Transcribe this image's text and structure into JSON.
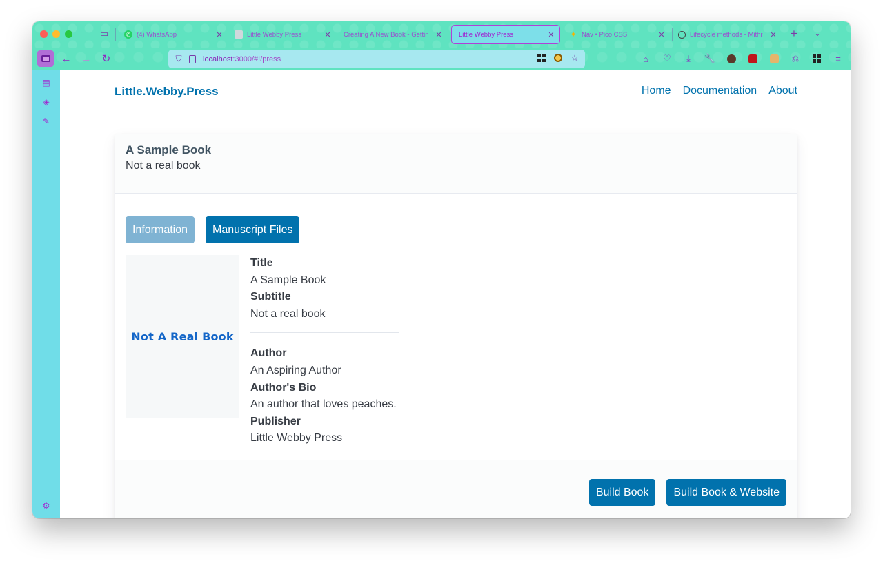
{
  "browser": {
    "tabs": [
      {
        "title": "(4) WhatsApp",
        "favicon_color": "#25d366",
        "active": false
      },
      {
        "title": "Little Webby Press",
        "favicon_color": "#cfd8dc",
        "active": false
      },
      {
        "title": "Creating A New Book - Gettin",
        "favicon_color": "",
        "active": false
      },
      {
        "title": "Little Webby Press",
        "favicon_color": "",
        "active": true
      },
      {
        "title": "Nav • Pico CSS",
        "favicon_color": "#f5b400",
        "active": false
      },
      {
        "title": "Lifecycle methods - Mithr",
        "favicon_color": "#444444",
        "active": false
      }
    ],
    "new_tab_label": "+",
    "url_host": "localhost",
    "url_rest": ":3000/#!/press"
  },
  "site": {
    "brand": "Little.Webby.Press",
    "nav": [
      "Home",
      "Documentation",
      "About"
    ]
  },
  "book": {
    "title": "A Sample Book",
    "subtitle": "Not a real book",
    "tabs": {
      "information": "Information",
      "manuscript": "Manuscript Files"
    },
    "cover_text": "Not A Real Book",
    "fields": {
      "title_label": "Title",
      "title_value": "A Sample Book",
      "subtitle_label": "Subtitle",
      "subtitle_value": "Not a real book",
      "author_label": "Author",
      "author_value": "An Aspiring Author",
      "bio_label": "Author's Bio",
      "bio_value": "An author that loves peaches.",
      "publisher_label": "Publisher",
      "publisher_value": "Little Webby Press"
    },
    "actions": {
      "build": "Build Book",
      "build_website": "Build Book & Website"
    }
  },
  "colors": {
    "accent": "#0172ad",
    "accent_muted": "#7fb3d3",
    "browser_theme": "#5fe3c0",
    "sidebar": "#70dde8"
  }
}
